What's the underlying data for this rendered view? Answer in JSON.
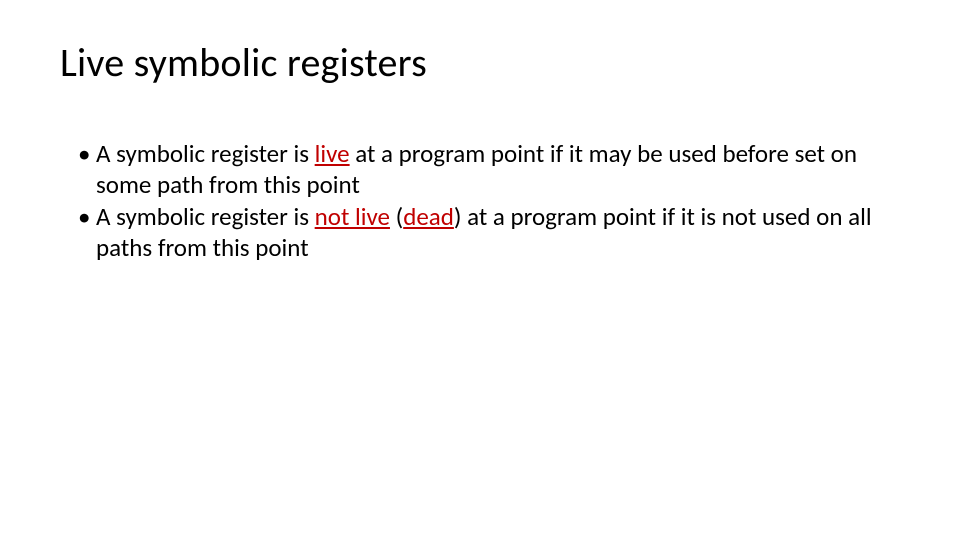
{
  "slide": {
    "title": "Live symbolic registers",
    "bullets": [
      {
        "pre": "A symbolic register is ",
        "highlight1": "live",
        "post": " at a program point if it may be used before set on some path from this point"
      },
      {
        "pre": "A symbolic register is ",
        "highlight1": "not live",
        "mid": " (",
        "highlight2": "dead",
        "post": ") at a program point if it is not used on all paths from this point"
      }
    ]
  }
}
